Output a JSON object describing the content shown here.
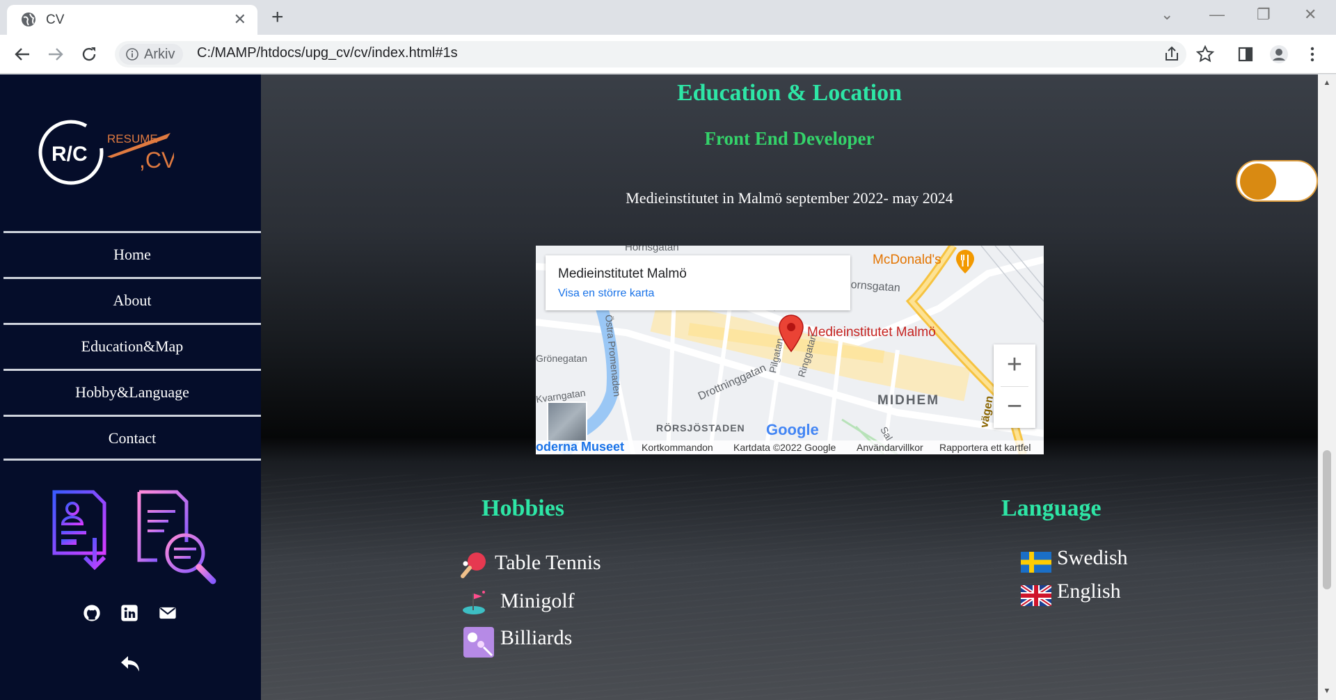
{
  "browser": {
    "tab_title": "CV",
    "site_chip": "Arkiv",
    "url": "C:/MAMP/htdocs/upg_cv/cv/index.html#1s"
  },
  "sidebar": {
    "logo_text": "R/C RESUME CV",
    "nav": [
      "Home",
      "About",
      "Education&Map",
      "Hobby&Language",
      "Contact"
    ],
    "social_icons": [
      "github-icon",
      "linkedin-icon",
      "email-icon"
    ]
  },
  "education": {
    "title": "Education & Location",
    "role": "Front End Developer",
    "line": "Medieinstitutet in Malmö september 2022- may 2024"
  },
  "map": {
    "info_title": "Medieinstitutet Malmö",
    "info_link": "Visa en större karta",
    "marker_label": "Medieinstitutet Malmö",
    "labels": {
      "mcdonalds": "McDonald's",
      "hornsgatan": "Hornsgatan",
      "hornsgatan_top": "Hornsgatan",
      "gronegatan": "Grönegatan",
      "kvarngatan": "Kvarngatan",
      "ostra": "Östra Promenaden",
      "drottninggatan": "Drottninggatan",
      "pilgatan": "Pilgatan",
      "ringgatan": "Ringgatan",
      "midhem": "MIDHEM",
      "rorsjostaden": "RÖRSJÖSTADEN",
      "google": "Google",
      "moderna": "oderna Museet",
      "vagen": "vägen",
      "sal": "Sal"
    },
    "footer": [
      "Kortkommandon",
      "Kartdata ©2022 Google",
      "Användarvillkor",
      "Rapportera ett kartfel"
    ]
  },
  "hobbies": {
    "title": "Hobbies",
    "items": [
      "Table Tennis",
      "Minigolf",
      "Billiards"
    ]
  },
  "language": {
    "title": "Language",
    "items": [
      "Swedish",
      "English"
    ]
  },
  "colors": {
    "accent_heading": "#2ee6a6",
    "accent_role": "#34d36a",
    "sidebar_bg": "#050d2a",
    "toggle_knob": "#d98a12"
  }
}
